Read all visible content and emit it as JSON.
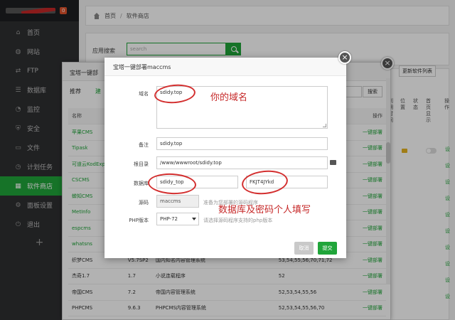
{
  "sidebar": {
    "badge": "0",
    "items": [
      {
        "label": "首页",
        "icon": "home-icon",
        "glyph": "⌂"
      },
      {
        "label": "网站",
        "icon": "globe-icon",
        "glyph": "◍"
      },
      {
        "label": "FTP",
        "icon": "ftp-icon",
        "glyph": "⇄"
      },
      {
        "label": "数据库",
        "icon": "database-icon",
        "glyph": "☰"
      },
      {
        "label": "监控",
        "icon": "monitor-icon",
        "glyph": "◔"
      },
      {
        "label": "安全",
        "icon": "shield-icon",
        "glyph": "⛨"
      },
      {
        "label": "文件",
        "icon": "folder-icon",
        "glyph": "▭"
      },
      {
        "label": "计划任务",
        "icon": "clock-icon",
        "glyph": "◷"
      },
      {
        "label": "软件商店",
        "icon": "grid-icon",
        "glyph": "▦",
        "active": true
      },
      {
        "label": "面板设置",
        "icon": "gear-icon",
        "glyph": "⚙"
      },
      {
        "label": "退出",
        "icon": "logout-icon",
        "glyph": "⏻"
      }
    ],
    "add": "+"
  },
  "breadcrumb": {
    "home": "首页",
    "sep": "/",
    "current": "软件商店"
  },
  "search": {
    "label": "应用搜索",
    "placeholder": "search"
  },
  "store": {
    "title": "宝塔一键部",
    "tabs": [
      "推荐",
      "建"
    ],
    "search_button": "搜索",
    "update_button": "更新软件列表",
    "columns": {
      "name": "名称",
      "op": "操作"
    },
    "right_headers": [
      "到期时间",
      "位置",
      "状态",
      "首页显示",
      "操作"
    ],
    "rows": [
      {
        "name": "苹果CMS",
        "ver": "",
        "desc": "",
        "php": "",
        "op": "一键部署",
        "green": true
      },
      {
        "name": "Tipask",
        "ver": "",
        "desc": "",
        "php": "",
        "op": "一键部署",
        "green": true
      },
      {
        "name": "可道云KodExp",
        "ver": "",
        "desc": "",
        "php": "",
        "op": "一键部署",
        "green": true
      },
      {
        "name": "CSCMS",
        "ver": "",
        "desc": "",
        "php": "",
        "op": "一键部署",
        "green": true
      },
      {
        "name": "蝉知CMS",
        "ver": "",
        "desc": "",
        "php": "",
        "op": "一键部署",
        "green": true
      },
      {
        "name": "MetInfo",
        "ver": "",
        "desc": "",
        "php": "",
        "op": "一键部署",
        "green": true
      },
      {
        "name": "espcms",
        "ver": "",
        "desc": "",
        "php": "",
        "op": "一键部署",
        "green": true
      },
      {
        "name": "whatsns",
        "ver": "",
        "desc": "",
        "php": "",
        "op": "一键部署",
        "green": true
      },
      {
        "name": "织梦CMS",
        "ver": "V5.7SP2",
        "desc": "国内知名内容管理系统",
        "php": "53,54,55,56,70,71,72",
        "op": "一键部署",
        "green": false
      },
      {
        "name": "杰奇1.7",
        "ver": "1.7",
        "desc": "小说连载程序",
        "php": "52",
        "op": "一键部署",
        "green": false
      },
      {
        "name": "帝国CMS",
        "ver": "7.2",
        "desc": "帝国内容管理系统",
        "php": "52,53,54,55,56",
        "op": "一键部署",
        "green": false
      },
      {
        "name": "PHPCMS",
        "ver": "9.6.3",
        "desc": "PHPCMS内容管理系统",
        "php": "52,53,54,55,56,70",
        "op": "一键部署",
        "green": false
      }
    ]
  },
  "dialog": {
    "title": "宝塔一键部署maccms",
    "domain_label": "域名",
    "domain_value": "sdidy.top",
    "remark_label": "备注",
    "remark_value": "sdidy.top",
    "root_label": "根目录",
    "root_value": "/www/wwwroot/sdidy.top",
    "db_label": "数据库",
    "db_user": "sdidy_top",
    "db_pass": "FKJT4JYkd",
    "source_label": "源码",
    "source_value": "maccms",
    "source_hint": "准备为您部署的源码程序",
    "php_label": "PHP版本",
    "php_value": "PHP-72",
    "php_hint": "请选择源码程序支持的php版本",
    "cancel": "取消",
    "submit": "提交"
  },
  "annotations": {
    "domain_note": "你的域名",
    "db_note": "数据库及密码个人填写",
    "color": "#c62828"
  }
}
